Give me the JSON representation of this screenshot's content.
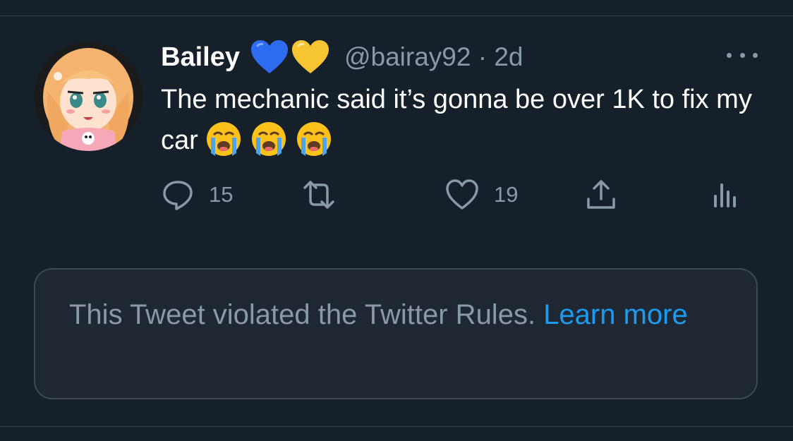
{
  "tweet": {
    "display_name": "Bailey",
    "name_emojis": [
      "blue-heart-icon",
      "yellow-heart-icon"
    ],
    "handle": "@bairay92",
    "separator": "·",
    "time": "2d",
    "text": "The mechanic said it’s gonna be over 1K to fix my car",
    "text_emojis": [
      "loudly-crying-face-icon",
      "loudly-crying-face-icon",
      "loudly-crying-face-icon"
    ]
  },
  "actions": {
    "reply_count": "15",
    "retweet_count": "",
    "like_count": "19"
  },
  "notice": {
    "text": "This Tweet violated the Twitter Rules.",
    "link": "Learn more"
  },
  "colors": {
    "background": "#15202b",
    "secondary_text": "#8b98a5",
    "link": "#1d9bf0",
    "notice_background": "#1e2732",
    "border": "#38444d"
  }
}
